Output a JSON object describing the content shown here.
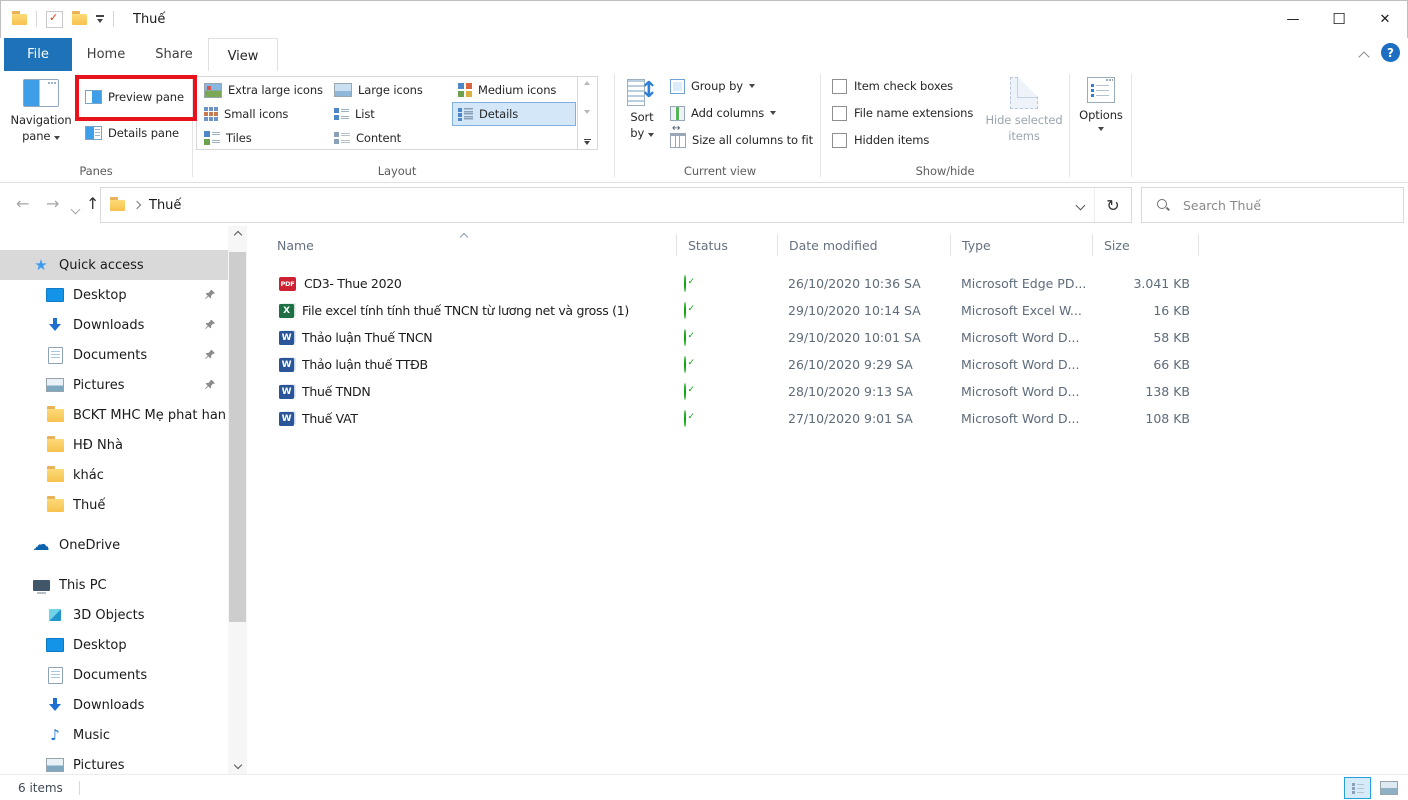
{
  "titlebar": {
    "title": "Thuế"
  },
  "tabs": {
    "file": "File",
    "home": "Home",
    "share": "Share",
    "view": "View"
  },
  "ribbon": {
    "panes": {
      "group_label": "Panes",
      "navigation_pane_line1": "Navigation",
      "navigation_pane_line2": "pane",
      "preview_pane": "Preview pane",
      "details_pane": "Details pane"
    },
    "layout": {
      "group_label": "Layout",
      "col1": [
        "Extra large icons",
        "Small icons",
        "Tiles"
      ],
      "col2": [
        "Large icons",
        "List",
        "Content"
      ],
      "col3": [
        "Medium icons",
        "Details"
      ],
      "selected": "Details"
    },
    "current_view": {
      "group_label": "Current view",
      "sort_by_line1": "Sort",
      "sort_by_line2": "by",
      "group_by": "Group by",
      "add_columns": "Add columns",
      "size_all_columns": "Size all columns to fit"
    },
    "show_hide": {
      "group_label": "Show/hide",
      "item_check_boxes": "Item check boxes",
      "file_name_extensions": "File name extensions",
      "hidden_items": "Hidden items",
      "hide_selected_line1": "Hide selected",
      "hide_selected_line2": "items"
    },
    "options": {
      "label": "Options"
    }
  },
  "address_bar": {
    "path": "Thuế",
    "search_placeholder": "Search Thuế"
  },
  "sidebar": {
    "quick_access_label": "Quick access",
    "quick_access_items": [
      {
        "label": "Desktop",
        "icon": "desktop-icon",
        "pinned": true
      },
      {
        "label": "Downloads",
        "icon": "downloads-icon",
        "pinned": true
      },
      {
        "label": "Documents",
        "icon": "documents-icon",
        "pinned": true
      },
      {
        "label": "Pictures",
        "icon": "pictures-icon",
        "pinned": true
      },
      {
        "label": "BCKT MHC Mẹ phat han",
        "icon": "folder-icon",
        "pinned": false
      },
      {
        "label": "HĐ Nhà",
        "icon": "folder-icon",
        "pinned": false
      },
      {
        "label": "khác",
        "icon": "folder-icon",
        "pinned": false
      },
      {
        "label": "Thuế",
        "icon": "folder-icon",
        "pinned": false
      }
    ],
    "onedrive_label": "OneDrive",
    "this_pc_label": "This PC",
    "this_pc_items": [
      {
        "label": "3D Objects",
        "icon": "3d-objects-icon"
      },
      {
        "label": "Desktop",
        "icon": "desktop-icon"
      },
      {
        "label": "Documents",
        "icon": "documents-icon"
      },
      {
        "label": "Downloads",
        "icon": "downloads-icon"
      },
      {
        "label": "Music",
        "icon": "music-icon"
      },
      {
        "label": "Pictures",
        "icon": "pictures-icon"
      }
    ]
  },
  "file_list": {
    "columns": [
      "Name",
      "Status",
      "Date modified",
      "Type",
      "Size"
    ],
    "rows": [
      {
        "name": "CD3- Thue  2020",
        "icon": "pdf-file-icon",
        "status": "synced",
        "date_modified": "26/10/2020 10:36 SA",
        "type": "Microsoft Edge PD...",
        "size": "3.041 KB"
      },
      {
        "name": "File excel tính tính thuế TNCN từ lương net và gross (1)",
        "icon": "excel-file-icon",
        "status": "synced",
        "date_modified": "29/10/2020 10:14 SA",
        "type": "Microsoft Excel W...",
        "size": "16 KB"
      },
      {
        "name": "Thảo luận Thuế TNCN",
        "icon": "word-file-icon",
        "status": "synced",
        "date_modified": "29/10/2020 10:01 SA",
        "type": "Microsoft Word D...",
        "size": "58 KB"
      },
      {
        "name": "Thảo luận thuế TTĐB",
        "icon": "word-file-icon",
        "status": "synced",
        "date_modified": "26/10/2020 9:29 SA",
        "type": "Microsoft Word D...",
        "size": "66 KB"
      },
      {
        "name": "Thuế TNDN",
        "icon": "word-file-icon",
        "status": "synced",
        "date_modified": "28/10/2020 9:13 SA",
        "type": "Microsoft Word D...",
        "size": "138 KB"
      },
      {
        "name": "Thuế VAT",
        "icon": "word-file-icon",
        "status": "synced",
        "date_modified": "27/10/2020 9:01 SA",
        "type": "Microsoft Word D...",
        "size": "108 KB"
      }
    ]
  },
  "status_bar": {
    "items_count": "6 items"
  },
  "colors": {
    "file_tab_blue": "#1e73b8",
    "highlight_red": "#e8121d",
    "selection_blue_bg": "#d3e7f8",
    "selection_blue_border": "#7fb2e3",
    "sync_green": "#0fa30f",
    "word_blue": "#2a5699",
    "excel_green": "#1d7044",
    "pdf_red": "#ce2233",
    "folder_yellow": "#f6c14e",
    "sidebar_selected_gray": "#d9d9d9"
  }
}
